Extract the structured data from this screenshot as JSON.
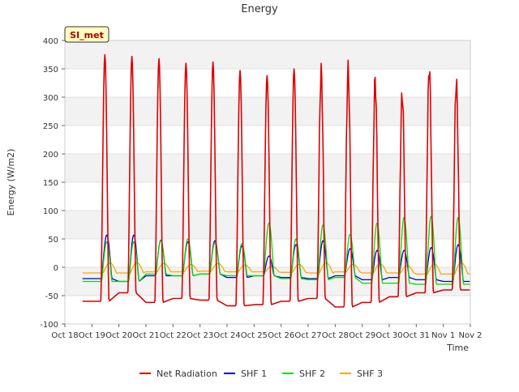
{
  "chart_data": {
    "type": "line",
    "title": "Energy",
    "xlabel": "Time",
    "ylabel": "Energy (W/m2)",
    "ylim": [
      -100,
      400
    ],
    "xlim": [
      "2023-10-18",
      "2023-11-02"
    ],
    "x_ticks": [
      "Oct 18",
      "Oct 19",
      "Oct 20",
      "Oct 21",
      "Oct 22",
      "Oct 23",
      "Oct 24",
      "Oct 25",
      "Oct 26",
      "Oct 27",
      "Oct 28",
      "Oct 29",
      "Oct 30",
      "Oct 31",
      "Nov 1",
      "Nov 2"
    ],
    "y_ticks": [
      -100,
      -50,
      0,
      50,
      100,
      150,
      200,
      250,
      300,
      350,
      400
    ],
    "grid": "horizontal bands",
    "legend_position": "bottom",
    "station_label": "SI_met",
    "days": [
      "2023-10-19",
      "2023-10-20",
      "2023-10-21",
      "2023-10-22",
      "2023-10-23",
      "2023-10-24",
      "2023-10-25",
      "2023-10-26",
      "2023-10-27",
      "2023-10-28",
      "2023-10-29",
      "2023-10-30",
      "2023-10-31",
      "2023-11-01"
    ],
    "series": [
      {
        "name": "Net Radiation",
        "color": "#dd0000",
        "daily_peak": [
          375,
          372,
          368,
          360,
          362,
          347,
          338,
          350,
          346,
          348,
          330,
          305,
          350,
          326
        ],
        "night_min": [
          -60,
          -45,
          -62,
          -55,
          -58,
          -68,
          -66,
          -60,
          -55,
          -70,
          -62,
          -52,
          -45,
          -40
        ]
      },
      {
        "name": "SHF 1",
        "color": "#0000dd",
        "daily_peak": [
          57,
          57,
          48,
          45,
          47,
          38,
          20,
          40,
          47,
          33,
          30,
          30,
          35,
          40
        ],
        "night_min": [
          -20,
          -25,
          -15,
          -15,
          -12,
          -18,
          -15,
          -18,
          -20,
          -15,
          -22,
          -18,
          -22,
          -25
        ]
      },
      {
        "name": "SHF 2",
        "color": "#00dd00",
        "daily_peak": [
          45,
          45,
          47,
          50,
          43,
          42,
          78,
          50,
          75,
          58,
          78,
          88,
          90,
          88
        ],
        "night_min": [
          -25,
          -25,
          -12,
          -15,
          -12,
          -15,
          -15,
          -20,
          -22,
          -18,
          -28,
          -28,
          -30,
          -30
        ]
      },
      {
        "name": "SHF 3",
        "color": "#ffa500",
        "daily_peak": [
          8,
          8,
          7,
          5,
          7,
          4,
          2,
          5,
          8,
          5,
          6,
          3,
          6,
          8
        ],
        "night_min": [
          -10,
          -10,
          -8,
          -8,
          -7,
          -8,
          -8,
          -9,
          -10,
          -8,
          -10,
          -10,
          -12,
          -12
        ]
      }
    ]
  }
}
